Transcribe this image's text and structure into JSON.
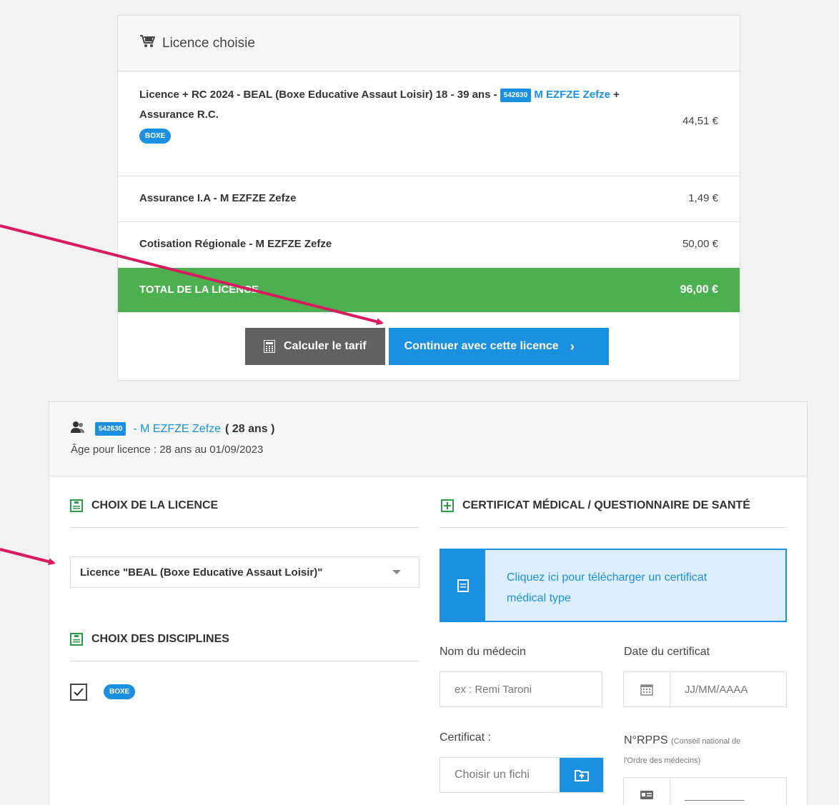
{
  "cart": {
    "title": "Licence choisie",
    "items": [
      {
        "label_part1": "Licence + RC 2024 - BEAL (Boxe Educative Assaut Loisir) 18 - 39 ans - ",
        "badge": "542630",
        "person": "M EZFZE Zefze",
        "label_part2": " + Assurance R.C.",
        "tag": "BOXE",
        "price": "44,51 €"
      },
      {
        "label": "Assurance I.A - M EZFZE Zefze",
        "price": "1,49 €"
      },
      {
        "label": "Cotisation Régionale - M EZFZE Zefze",
        "price": "50,00 €"
      }
    ],
    "total_label": "TOTAL DE LA LICENCE",
    "total_value": "96,00 €",
    "calc_button": "Calculer le tarif",
    "continue_button": "Continuer avec cette licence",
    "continue_chevron": "›"
  },
  "member": {
    "id_badge": "542630",
    "name": "- M EZFZE Zefze",
    "age_paren": "( 28 ans )",
    "age_line": "Âge pour licence : 28 ans au 01/09/2023"
  },
  "licence_choice": {
    "title": "CHOIX DE LA LICENCE",
    "selected": "Licence \"BEAL (Boxe Educative Assaut Loisir)\""
  },
  "disciplines": {
    "title": "CHOIX DES DISCIPLINES",
    "tag": "BOXE"
  },
  "medical": {
    "title": "CERTIFICAT MÉDICAL / QUESTIONNAIRE DE SANTÉ",
    "download_text": "Cliquez ici pour télécharger un certificat médical type",
    "doctor_label": "Nom du médecin",
    "doctor_placeholder": "ex : Remi Taroni",
    "date_label": "Date du certificat",
    "date_placeholder": "JJ/MM/AAAA",
    "cert_label": "Certificat :",
    "file_placeholder": "Choisir un fichi",
    "rpps_label": "N°RPPS",
    "rpps_note1": "(Conseil national de",
    "rpps_note2": "l'Ordre des médecins)",
    "rpps_value": "__________"
  },
  "colors": {
    "primary": "#1b8fe0",
    "success": "#4caf50",
    "annotation": "#d81b60",
    "grey_button": "#616161"
  }
}
